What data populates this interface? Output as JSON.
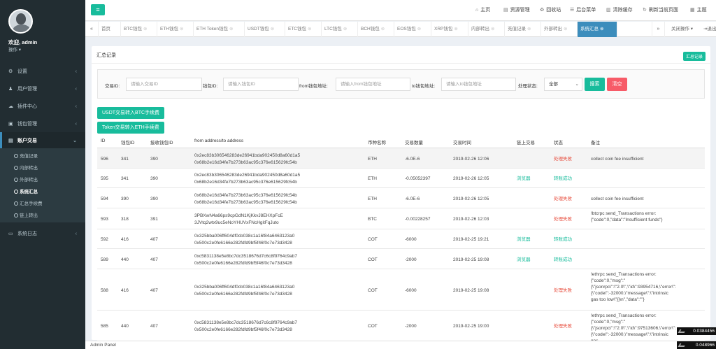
{
  "sidebar": {
    "user": "欢迎, admin",
    "user_action": "操作 ▾",
    "menu": [
      {
        "label": "设置",
        "icon": "gears-icon"
      },
      {
        "label": "用户管理",
        "icon": "user-icon"
      },
      {
        "label": "插件中心",
        "icon": "cloud-icon"
      },
      {
        "label": "钱包管理",
        "icon": "wallet-icon"
      },
      {
        "label": "账户交易",
        "icon": "table-icon"
      },
      {
        "label": "系统日志",
        "icon": "desktop-icon"
      }
    ],
    "submenu": [
      "充值记录",
      "内部转出",
      "外部转出",
      "系统汇总",
      "汇总手续费",
      "链上转出"
    ]
  },
  "topbar": {
    "links": [
      "主页",
      "资源管理",
      "回收站",
      "后台菜单",
      "清除缓存",
      "刷新当前页面",
      "主题"
    ]
  },
  "tabs": {
    "items": [
      "首页",
      "BTC钱包",
      "ETH钱包",
      "ETH Token钱包",
      "USDT钱包",
      "ETC钱包",
      "LTC钱包",
      "BCH钱包",
      "EOS钱包",
      "XRP钱包",
      "内部转出",
      "充值记录",
      "外部转出",
      "系统汇总"
    ],
    "close_label": "关闭操作 ▾",
    "exit_label": "退出"
  },
  "panel": {
    "title": "汇总记录",
    "badge": "汇总记录"
  },
  "search": {
    "txid_label": "交易ID:",
    "txid_placeholder": "请输入交易ID",
    "wallet_label": "钱包ID:",
    "wallet_placeholder": "请输入钱包ID",
    "from_label": "from钱包地址:",
    "from_placeholder": "请输入from钱包地址",
    "to_label": "to钱包地址:",
    "to_placeholder": "请输入to钱包地址",
    "status_label": "处理状态:",
    "status_value": "全部",
    "search_btn": "搜索",
    "clear_btn": "清空"
  },
  "actions": {
    "usdt_btn": "USDT交易转入BTC手续费",
    "token_btn": "Token交易转入ETH手续费"
  },
  "table": {
    "headers": [
      "ID",
      "钱包ID",
      "接收钱包ID",
      "from address/to address",
      "币种名称",
      "交易数量",
      "交易时间",
      "链上交易",
      "状态",
      "备注"
    ],
    "rows": [
      {
        "id": "596",
        "wallet": "341",
        "recv": "390",
        "from": "0x2ec83b306546283de26941bda902450d8a60d1a5",
        "to": "0x68b2e16d34fe7b273b63ac95c376e615629fc54b",
        "coin": "ETH",
        "amount": "-6.0E-6",
        "time": "2019-02-26 12:06",
        "chain": "",
        "status": "处理失败",
        "remark": "collect coin fee insufficient"
      },
      {
        "id": "595",
        "wallet": "341",
        "recv": "390",
        "from": "0x2ec83b306546283de26941bda902450d8a60d1a5",
        "to": "0x68b2e16d34fe7b273b63ac95c376e615629fc54b",
        "coin": "ETH",
        "amount": "-0.05052397",
        "time": "2019-02-26 12:05",
        "chain": "浏览器",
        "status": "转账成功",
        "remark": ""
      },
      {
        "id": "594",
        "wallet": "390",
        "recv": "390",
        "from": "0x68b2e16d34fe7b273b63ac95c376e615629fc54b",
        "to": "0x68b2e16d34fe7b273b63ac95c376e615629fc54b",
        "coin": "ETH",
        "amount": "-6.0E-6",
        "time": "2019-02-26 12:05",
        "chain": "",
        "status": "处理失败",
        "remark": "collect coin fee insufficient"
      },
      {
        "id": "593",
        "wallet": "318",
        "recv": "391",
        "from": "3PBXwN4a66ps9cpGdN1KjKkvJ8EHXpFcE",
        "to": "3JVtq2wtx9uc5eNoYHUVxFNcHgitFqJuto",
        "coin": "BTC",
        "amount": "-0.00228257",
        "time": "2019-02-26 12:03",
        "chain": "",
        "status": "处理失败",
        "remark": "!btcrpc send_Transactions error:{\"code\":0,\"data\":\"Insufficient funds\"}"
      },
      {
        "id": "592",
        "wallet": "416",
        "recv": "407",
        "from": "0x325bba006ff604df0cb038c1a16f84a6463123a0",
        "to": "0x500c2e0fe6166e282fdfd9bf5f46f0c7e73d3428",
        "coin": "COT",
        "amount": "-6000",
        "time": "2019-02-25 19:21",
        "chain": "浏览器",
        "status": "转账成功",
        "remark": ""
      },
      {
        "id": "589",
        "wallet": "440",
        "recv": "407",
        "from": "0xc5831138e5e8bc7dc3518676d7c6c8f9764c9ab7",
        "to": "0x500c2e0fe6166e282fdfd9bf5f46f0c7e73d3428",
        "coin": "COT",
        "amount": "-2000",
        "time": "2019-02-25 19:08",
        "chain": "浏览器",
        "status": "转账成功",
        "remark": ""
      },
      {
        "id": "588",
        "wallet": "416",
        "recv": "407",
        "from": "0x325bba006ff604df0cb038c1a16f84a6463123a0",
        "to": "0x500c2e0fe6166e282fdfd9bf5f46f0c7e73d3428",
        "coin": "COT",
        "amount": "-6000",
        "time": "2019-02-25 19:08",
        "chain": "",
        "status": "处理失败",
        "remark": "!ethrpc send_Transactions error:{\"code\":0,\"msg\":\"{\\\"jsonrpc\\\":\\\"2.0\\\",\\\"id\\\":93954716,\\\"error\\\":{\\\"code\\\":-32000,\\\"message\\\":\\\"intrinsic gas too low\\\"}}\\n\",\"data\":\"\"}"
      },
      {
        "id": "585",
        "wallet": "440",
        "recv": "407",
        "from": "0xc5831138e5e8bc7dc3518676d7c6c8f9764c9ab7",
        "to": "0x500c2e0fe6166e282fdfd9bf5f46f0c7e73d3428",
        "coin": "COT",
        "amount": "-2000",
        "time": "2019-02-25 19:00",
        "chain": "",
        "status": "处理失败",
        "remark": "!ethrpc send_Transactions error:{\"code\":0,\"msg\":\"{\\\"jsonrpc\\\":\\\"2.0\\\",\\\"id\\\":97513606,\\\"error\\\":{\\\"code\\\":-32000,\\\"message\\\":\\\"intrinsic gas"
      }
    ]
  },
  "footer": {
    "text": "Admin Panel"
  },
  "floats": [
    "0.0384456",
    "0.048966"
  ],
  "colors": {
    "sidebar": "#222d32",
    "primary": "#18bc9c",
    "danger": "#e74c3c",
    "tab_active": "#3c8dbc"
  }
}
